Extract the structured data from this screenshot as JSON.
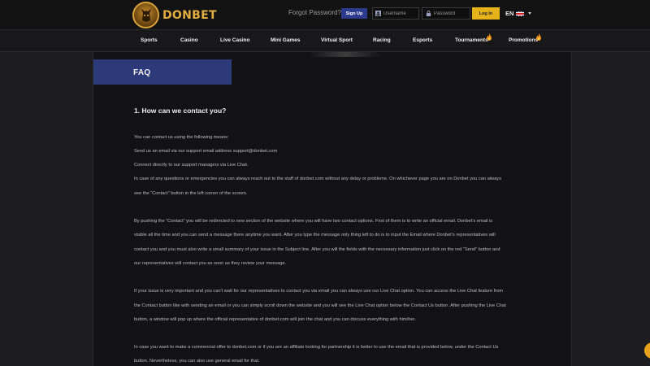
{
  "brand": {
    "name": "DONBET",
    "accent": "#e2ad3f"
  },
  "header": {
    "forgot_password": "Forgot Password?",
    "signup_label": "Sign Up",
    "username_placeholder": "Username",
    "password_placeholder": "Password",
    "login_label": "Log In",
    "language": "EN"
  },
  "nav": {
    "items": [
      {
        "label": "Sports"
      },
      {
        "label": "Casino"
      },
      {
        "label": "Live Casino"
      },
      {
        "label": "Mini Games"
      },
      {
        "label": "Virtual Sport"
      },
      {
        "label": "Racing"
      },
      {
        "label": "Esports"
      },
      {
        "label": "Tournaments",
        "icon": "fire-icon"
      },
      {
        "label": "Promotions",
        "icon": "fire-icon"
      }
    ]
  },
  "faq": {
    "title": "FAQ",
    "question": "1. How can we contact you?",
    "lines": [
      "You can contact us using the following means:",
      "Send us an email via our support email address support@donbet.com",
      "Connect directly to our support managers via Live Chat.",
      "In case of any questions or emergencies you can always reach out to the staff of donbet.com without any delay or probleme. On whichever page you are on Donbet you can always",
      "see the “Contact” button in the left corner of the screen.",
      "By pushing the “Contact” you will be redirected to new section of the website where you will have two contact options. First of them is to write an official email. Donbet’s email is",
      "visible all the time and you can send a message there anytime you want. After you type the message only thing left to do is to input the Email where Donbet’s representatives will",
      "contact you and you must also write a small summary of your issue in the Subject line. After you will the fields with the necessary information just click on the red “Send” button and",
      "our representatives will contact you as soon as they review your message.",
      "If your issue is very important and you can't wait for our representatives to contact you via email you can always use our Live Chat option. You can access the Live Chat feature from",
      "the Contact button like with sending an email or you can simply scroll down the website and you will see the Live Chat option below the Contact Us button. After pushing the Live Chat",
      "button, a window will pop up where the official representative of donbet.com will join the chat and you can discuss everything with him/her.",
      "In case you want to make a commercial offer to donbet.com or if you are an affiliate looking for partnership it is better to use the email that is provided below, under the Contact Us",
      "button. Nevertheless, you can also use general email for that."
    ]
  }
}
